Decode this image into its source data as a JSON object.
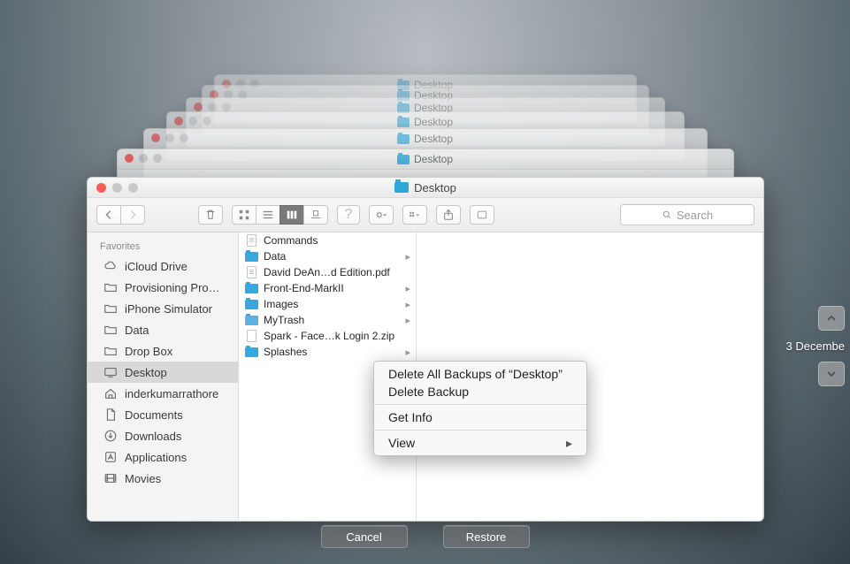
{
  "window_title": "Desktop",
  "search_placeholder": "Search",
  "sidebar": {
    "header": "Favorites",
    "items": [
      {
        "label": "iCloud Drive",
        "icon": "cloud",
        "selected": false
      },
      {
        "label": "Provisioning Pro…",
        "icon": "folder",
        "selected": false
      },
      {
        "label": "iPhone Simulator",
        "icon": "folder",
        "selected": false
      },
      {
        "label": "Data",
        "icon": "folder",
        "selected": false
      },
      {
        "label": "Drop Box",
        "icon": "folder",
        "selected": false
      },
      {
        "label": "Desktop",
        "icon": "desktop",
        "selected": true
      },
      {
        "label": "inderkumarrathore",
        "icon": "home",
        "selected": false
      },
      {
        "label": "Documents",
        "icon": "doc",
        "selected": false
      },
      {
        "label": "Downloads",
        "icon": "download",
        "selected": false
      },
      {
        "label": "Applications",
        "icon": "app",
        "selected": false
      },
      {
        "label": "Movies",
        "icon": "movie",
        "selected": false
      }
    ]
  },
  "files": [
    {
      "name": "Commands",
      "type": "txt",
      "expandable": false
    },
    {
      "name": "Data",
      "type": "folder",
      "expandable": true
    },
    {
      "name": "David DeAn…d Edition.pdf",
      "type": "pdf",
      "expandable": false
    },
    {
      "name": "Front-End-MarkII",
      "type": "folder",
      "expandable": true
    },
    {
      "name": "Images",
      "type": "folder",
      "expandable": true
    },
    {
      "name": "MyTrash",
      "type": "folder-alt",
      "expandable": true
    },
    {
      "name": "Spark - Face…k Login 2.zip",
      "type": "zip",
      "expandable": false
    },
    {
      "name": "Splashes",
      "type": "folder",
      "expandable": true
    }
  ],
  "context_menu": {
    "delete_all": "Delete All Backups of “Desktop”",
    "delete_one": "Delete Backup",
    "get_info": "Get Info",
    "view": "View"
  },
  "bottom": {
    "cancel": "Cancel",
    "restore": "Restore"
  },
  "nav_date": "3 Decembe"
}
